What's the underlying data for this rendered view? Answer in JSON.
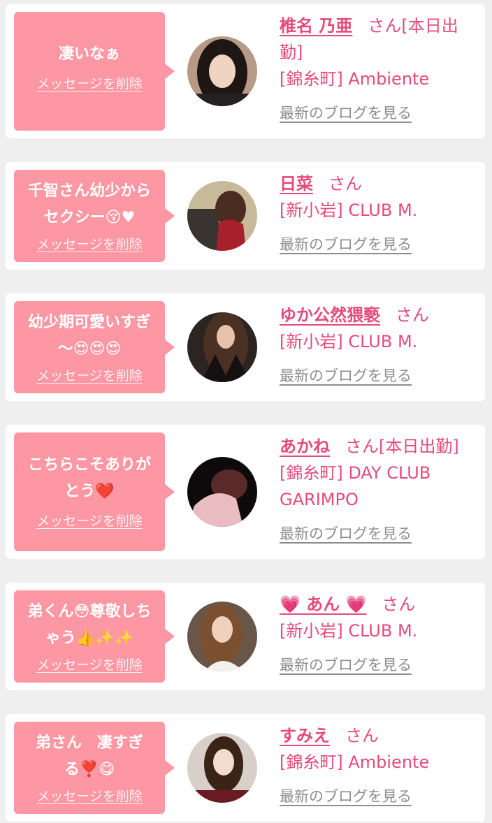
{
  "colors": {
    "page_bg": "#efefef",
    "card_bg": "#ffffff",
    "bubble_bg": "#fd97a3",
    "accent_pink": "#e64a7a",
    "link_gray": "#8d8d8d"
  },
  "items": [
    {
      "message": "凄いなぁ",
      "delete_label": "メッセージを削除",
      "name": "椎名 乃亜",
      "honorific": "さん[本日出勤]",
      "shop": "[錦糸町] Ambiente",
      "blog_label": "最新のブログを見る",
      "avatar_icon": "woman-portrait-photo"
    },
    {
      "message": "千智さん幼少から\nセクシー😚♥",
      "delete_label": "メッセージを削除",
      "name": "日菜",
      "honorific": "さん",
      "shop": "[新小岩] CLUB M.",
      "blog_label": "最新のブログを見る",
      "avatar_icon": "woman-red-dress-photo"
    },
    {
      "message": "幼少期可愛いすぎ\n〜😍😍😍",
      "delete_label": "メッセージを削除",
      "name": "ゆか公然猥褻",
      "honorific": "さん",
      "shop": "[新小岩] CLUB M.",
      "blog_label": "最新のブログを見る",
      "avatar_icon": "woman-black-outfit-photo"
    },
    {
      "message": "こちらこそありが\nとう❤️",
      "delete_label": "メッセージを削除",
      "name": "あかね",
      "honorific": "さん[本日出勤]",
      "shop": "[錦糸町] DAY CLUB GARIMPO",
      "blog_label": "最新のブログを見る",
      "avatar_icon": "pink-blouse-photo"
    },
    {
      "message": "弟くん😳尊敬しち\nゃう👍✨✨",
      "delete_label": "メッセージを削除",
      "name": "💗 あん 💗",
      "honorific": "さん",
      "shop": "[新小岩] CLUB M.",
      "blog_label": "最新のブログを見る",
      "avatar_icon": "woman-portrait-photo"
    },
    {
      "message": "弟さん　凄すぎ\nる❣️😋",
      "delete_label": "メッセージを削除",
      "name": "すみえ",
      "honorific": "さん",
      "shop": "[錦糸町] Ambiente",
      "blog_label": "最新のブログを見る",
      "avatar_icon": "woman-portrait-photo"
    }
  ]
}
